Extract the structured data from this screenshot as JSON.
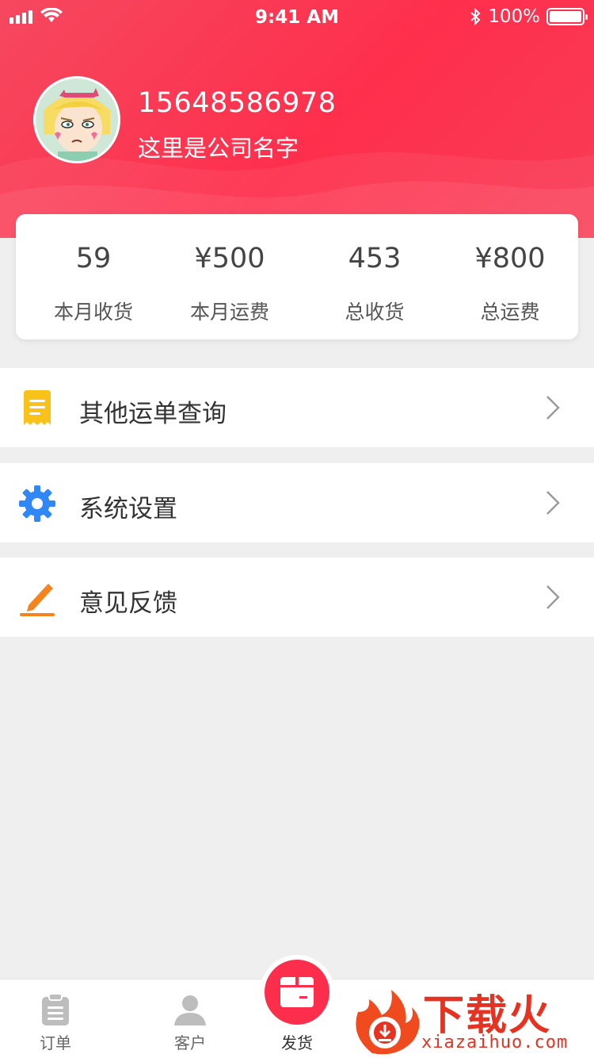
{
  "status_bar": {
    "time": "9:41 AM",
    "battery": "100%"
  },
  "profile": {
    "phone": "15648586978",
    "company": "这里是公司名字"
  },
  "stats": [
    {
      "value": "59",
      "label": "本月收货"
    },
    {
      "value": "¥500",
      "label": "本月运费"
    },
    {
      "value": "453",
      "label": "总收货"
    },
    {
      "value": "¥800",
      "label": "总运费"
    }
  ],
  "menu": [
    {
      "label": "其他运单查询",
      "icon": "receipt-icon",
      "color": "#f9c21a"
    },
    {
      "label": "系统设置",
      "icon": "gear-icon",
      "color": "#2f88f6"
    },
    {
      "label": "意见反馈",
      "icon": "pencil-icon",
      "color": "#f5841f"
    }
  ],
  "tabbar": {
    "orders": "订单",
    "customers": "客户",
    "ship": "发货"
  },
  "watermark": {
    "title": "下载火",
    "url": "xiazaihuo.com"
  },
  "colors": {
    "brand": "#fe2f4c",
    "background": "#efefef"
  }
}
